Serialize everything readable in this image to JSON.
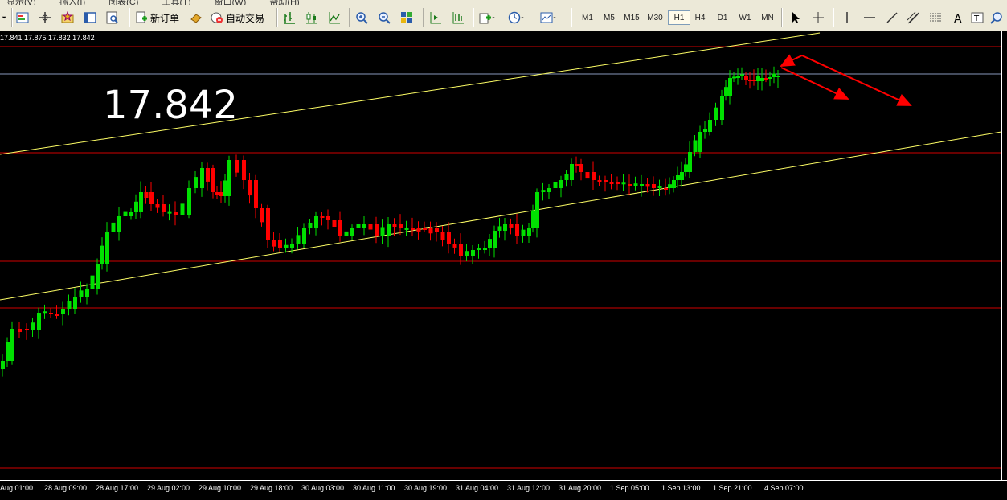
{
  "toolbar": {
    "new_order_label": "新订单",
    "auto_trading_label": "自动交易",
    "timeframes": [
      "M1",
      "M5",
      "M15",
      "M30",
      "H1",
      "H4",
      "D1",
      "W1",
      "MN"
    ],
    "active_timeframe": "H1"
  },
  "chart": {
    "ohlc_text": "17.841 17.875 17.832 17.842",
    "current_price_annotation": "17.842",
    "time_labels": [
      "Aug 01:00",
      "28 Aug 09:00",
      "28 Aug 17:00",
      "29 Aug 02:00",
      "29 Aug 10:00",
      "29 Aug 18:00",
      "30 Aug 03:00",
      "30 Aug 11:00",
      "30 Aug 19:00",
      "31 Aug 04:00",
      "31 Aug 12:00",
      "31 Aug 20:00",
      "1 Sep 05:00",
      "1 Sep 13:00",
      "1 Sep 21:00",
      "4 Sep 07:00"
    ],
    "colors": {
      "background": "#000000",
      "bull": "#00e000",
      "bear": "#ff0000",
      "channel": "#ffff66",
      "level": "#d00000",
      "arrow": "#ff0000",
      "bid": "#8899bb"
    }
  }
}
